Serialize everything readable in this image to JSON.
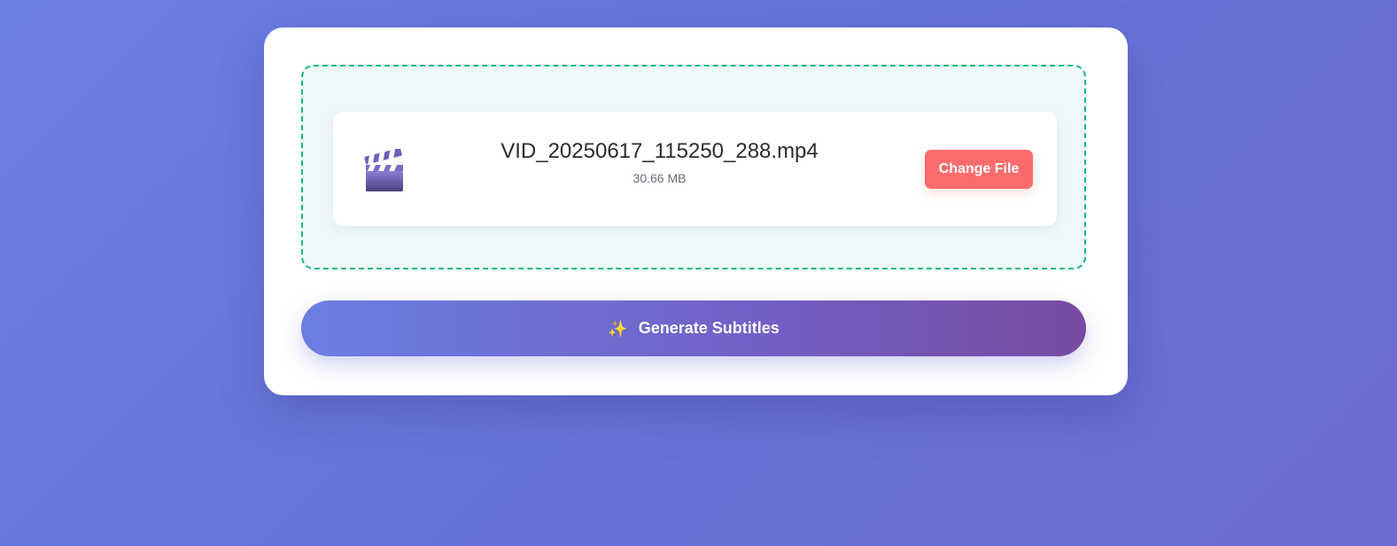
{
  "file": {
    "name": "VID_20250617_115250_288.mp4",
    "size": "30.66 MB",
    "icon": "clapperboard-icon"
  },
  "buttons": {
    "change_file": "Change File",
    "generate": "Generate Subtitles",
    "generate_icon": "sparkles-icon",
    "generate_icon_glyph": "✨"
  },
  "colors": {
    "dropzone_border": "#10b981",
    "change_button": "#fc6c6c",
    "gradient_start": "#6a7fe3",
    "gradient_end": "#764ba2"
  }
}
